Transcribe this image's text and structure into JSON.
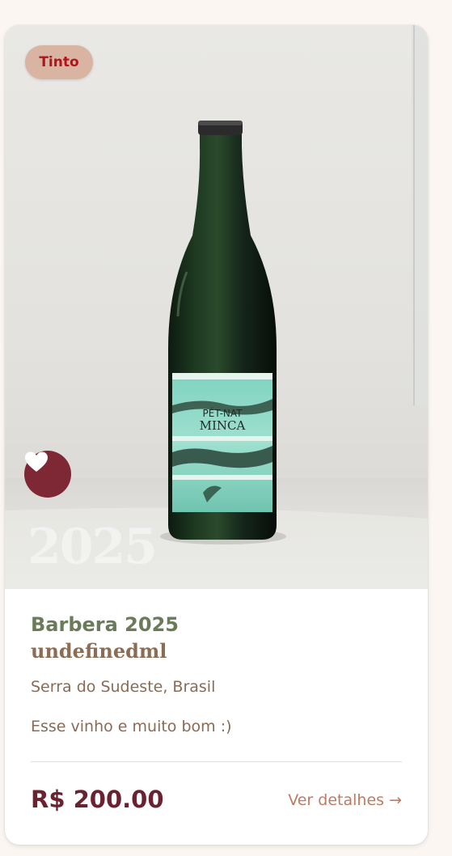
{
  "card": {
    "badge": "Tinto",
    "year_watermark": "2025",
    "name": "Barbera 2025",
    "producer": "undefinedml",
    "region": "Serra do Sudeste, Brasil",
    "description": "Esse vinho e muito bom :)",
    "price": "R$ 200.00",
    "details_link": "Ver detalhes →",
    "favorite_icon": "heart-icon",
    "bottle_label": {
      "line1": "PÉT-NAT",
      "line2": "MINCA"
    }
  },
  "colors": {
    "accent": "#7d2834",
    "badge_bg": "#d9b4a2",
    "badge_text": "#b3141b",
    "name": "#6b7a58",
    "price": "#6b2230",
    "link": "#c07a62"
  }
}
